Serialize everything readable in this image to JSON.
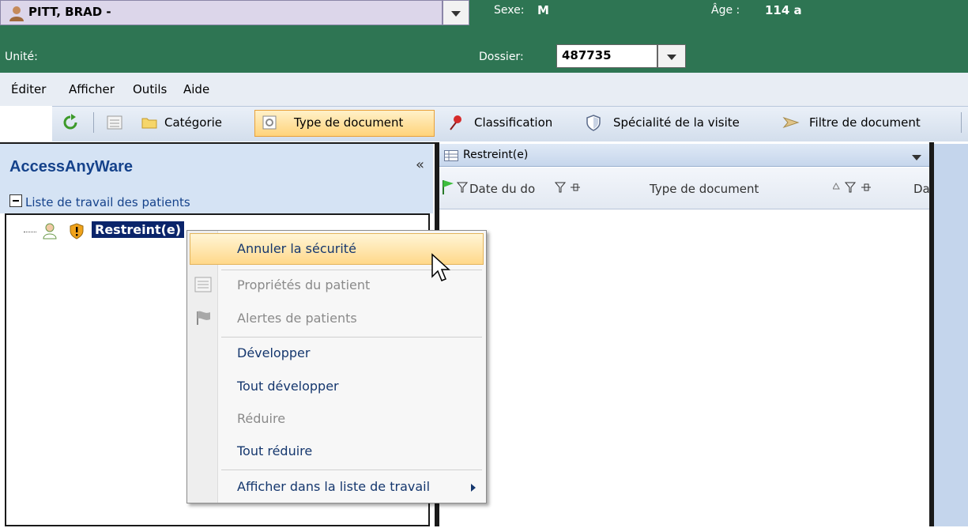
{
  "header": {
    "patient_name": "PITT, BRAD -",
    "sexe_label": "Sexe:",
    "sexe_value": "M",
    "age_label": "Âge :",
    "age_value": "114 a",
    "unite_label": "Unité:",
    "dossier_label": "Dossier:",
    "dossier_value": "487735"
  },
  "menubar": {
    "items": [
      "Éditer",
      "Afficher",
      "Outils",
      "Aide"
    ]
  },
  "toolbar": {
    "categorie": "Catégorie",
    "type_document": "Type de document",
    "classification": "Classification",
    "specialite": "Spécialité de la visite",
    "filtre": "Filtre de document"
  },
  "left_panel": {
    "title": "AccessAnyWare",
    "collapse": "«",
    "worklist_label": "Liste de travail des patients",
    "tree_item": "Restreint(e)"
  },
  "center_panel": {
    "title": "Restreint(e)",
    "columns": [
      "Date du do",
      "Type de document",
      "Da"
    ]
  },
  "context_menu": {
    "items": [
      {
        "label": "Annuler la sécurité",
        "enabled": true
      },
      {
        "label": "Propriétés du patient",
        "enabled": false
      },
      {
        "label": "Alertes de patients",
        "enabled": false
      },
      {
        "label": "Développer",
        "enabled": true
      },
      {
        "label": "Tout développer",
        "enabled": true
      },
      {
        "label": "Réduire",
        "enabled": false
      },
      {
        "label": "Tout réduire",
        "enabled": true
      },
      {
        "label": "Afficher dans la liste de travail",
        "enabled": true
      }
    ]
  },
  "colors": {
    "header_green": "#2e7553",
    "patient_box": "#dcd6ea",
    "menu_text": "#15376e",
    "hover_orange": "#ffd88a"
  }
}
